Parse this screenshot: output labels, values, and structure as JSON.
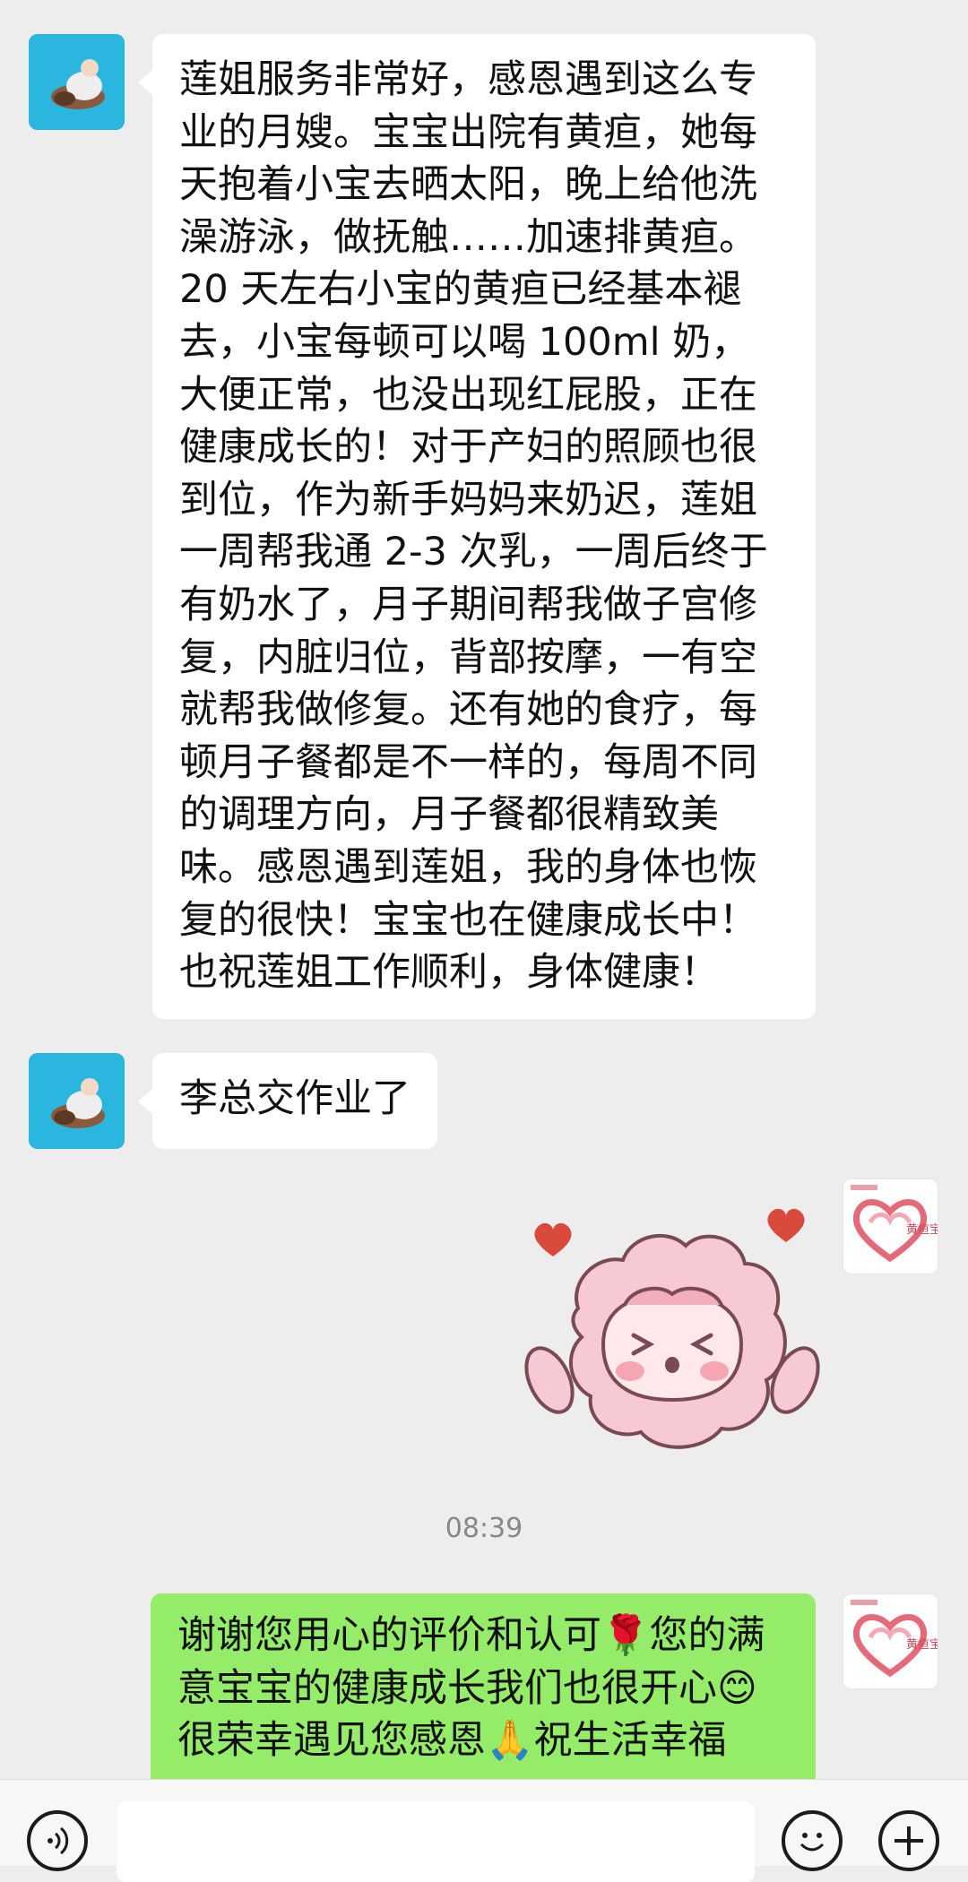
{
  "messages": [
    {
      "id": "msg1",
      "direction": "incoming",
      "text": "莲姐服务非常好，感恩遇到这么专\n业的月嫂。宝宝出院有黄疸，她每\n天抱着小宝去晒太阳，晚上给他洗\n澡游泳，做抚触……加速排黄疸。\n20 天左右小宝的黄疸已经基本褪\n去，小宝每顿可以喝 100ml 奶，\n大便正常，也没出现红屁股，正在\n健康成长的！对于产妇的照顾也很\n到位，作为新手妈妈来奶迟，莲姐\n一周帮我通 2-3 次乳，一周后终于\n有奶水了，月子期间帮我做子宫修\n复，内脏归位，背部按摩，一有空\n就帮我做修复。还有她的食疗，每\n顿月子餐都是不一样的，每周不同\n的调理方向，月子餐都很精致美\n味。感恩遇到莲姐，我的身体也恢\n复的很快！宝宝也在健康成长中！\n也祝莲姐工作顺利，身体健康！"
    },
    {
      "id": "msg2",
      "direction": "incoming",
      "text": "李总交作业了"
    },
    {
      "id": "msg3",
      "direction": "outgoing",
      "type": "sticker",
      "sticker": "pink-sheep-sticker"
    },
    {
      "id": "msg4",
      "direction": "outgoing",
      "text": "谢谢您用心的评价和认可🌹您的满\n意宝宝的健康成长我们也很开心😊\n很荣幸遇见您感恩🙏祝生活幸福"
    }
  ],
  "timestamp": "08:39",
  "right_avatar_label": "黄疸宝贝",
  "icons": {
    "voice": "voice-icon",
    "emoji": "emoji-icon",
    "plus": "plus-icon"
  },
  "colors": {
    "background": "#ededed",
    "incoming_bubble": "#ffffff",
    "outgoing_bubble": "#95ec69",
    "heart": "#e74c3c",
    "sheep": "#f7c9d4"
  }
}
